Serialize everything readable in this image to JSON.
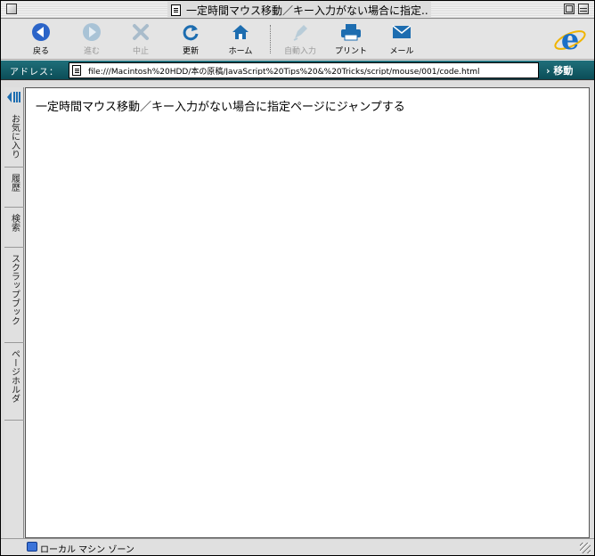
{
  "window": {
    "title": "一定時間マウス移動／キー入力がない場合に指定..."
  },
  "toolbar": {
    "items": [
      {
        "label": "戻る",
        "icon": "back-arrow-icon",
        "enabled": true
      },
      {
        "label": "進む",
        "icon": "forward-arrow-icon",
        "enabled": false
      },
      {
        "label": "中止",
        "icon": "stop-icon",
        "enabled": false
      },
      {
        "label": "更新",
        "icon": "refresh-icon",
        "enabled": true
      },
      {
        "label": "ホーム",
        "icon": "home-icon",
        "enabled": true
      },
      {
        "label": "自動入力",
        "icon": "autofill-icon",
        "enabled": false
      },
      {
        "label": "プリント",
        "icon": "printer-icon",
        "enabled": true
      },
      {
        "label": "メール",
        "icon": "mail-icon",
        "enabled": true
      }
    ]
  },
  "address": {
    "label": "アドレス：",
    "url": "file:///Macintosh%20HDD/本の原稿/JavaScript%20Tips%20&%20Tricks/script/mouse/001/code.html",
    "go_label": "› 移動"
  },
  "explorer": {
    "tabs": [
      {
        "label": "お気に入り"
      },
      {
        "label": "履歴"
      },
      {
        "label": "検索"
      },
      {
        "label": "スクラップブック"
      },
      {
        "label": "ページホルダ"
      }
    ]
  },
  "page": {
    "text": "一定時間マウス移動／キー入力がない場合に指定ページにジャンプする"
  },
  "status": {
    "zone": "ローカル マシン ゾーン"
  },
  "colors": {
    "address_bar": "#0b4d57",
    "accent_blue": "#2b64c8"
  }
}
